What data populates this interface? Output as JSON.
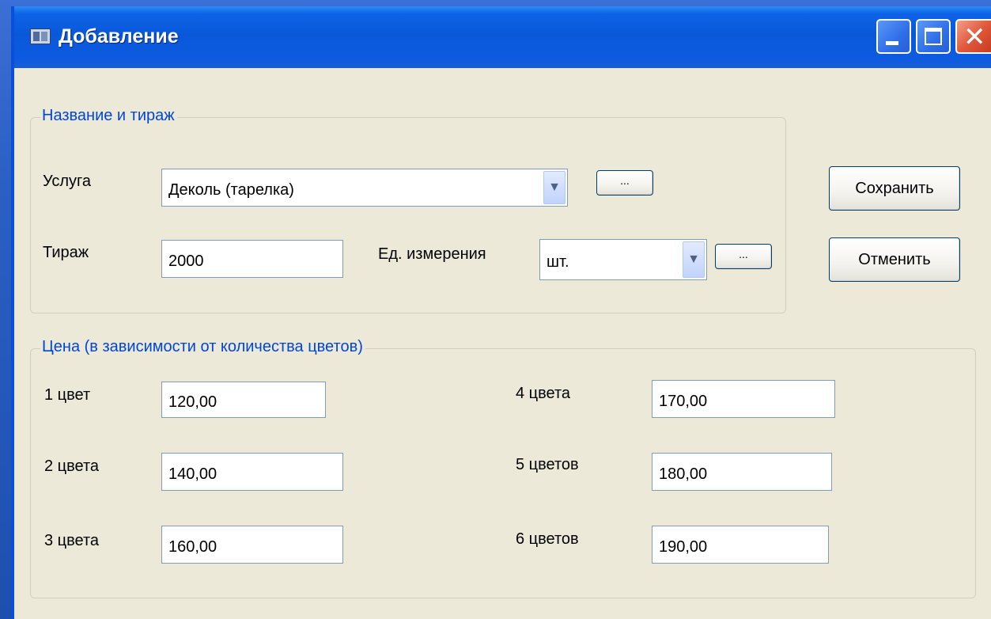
{
  "window": {
    "title": "Добавление"
  },
  "group_name": {
    "legend": "Название и тираж",
    "service_label": "Услуга",
    "service_value": "Деколь (тарелка)",
    "service_browse": "...",
    "run_label": "Тираж",
    "run_value": "2000",
    "unit_label": "Ед. измерения",
    "unit_value": "шт.",
    "unit_browse": "..."
  },
  "buttons": {
    "save": "Сохранить",
    "cancel": "Отменить"
  },
  "group_price": {
    "legend": "Цена (в зависимости от количества цветов)",
    "rows": [
      {
        "label": "1 цвет",
        "value": "120,00"
      },
      {
        "label": "2 цвета",
        "value": "140,00"
      },
      {
        "label": "3 цвета",
        "value": "160,00"
      },
      {
        "label": "4 цвета",
        "value": "170,00"
      },
      {
        "label": "5 цветов",
        "value": "180,00"
      },
      {
        "label": "6 цветов",
        "value": "190,00"
      }
    ]
  },
  "colors": {
    "title_bar": "#0a58da",
    "window_bg": "#ece9d8",
    "legend_text": "#0046d5",
    "close_button": "#e0573a"
  },
  "icons": {
    "window_icon": "window-form-icon",
    "minimize": "minimize-icon",
    "maximize": "maximize-icon",
    "close": "close-icon",
    "dropdown": "chevron-down-icon"
  }
}
